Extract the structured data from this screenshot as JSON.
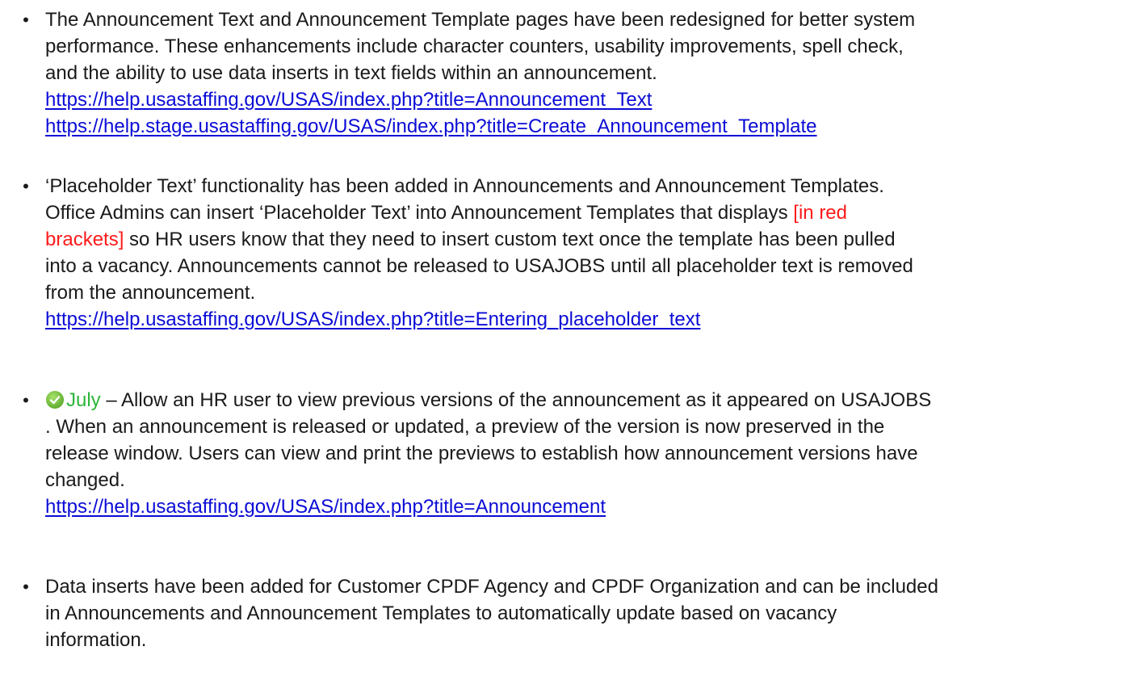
{
  "bullet_char": "•",
  "items": [
    {
      "lines": [
        "The Announcement Text and Announcement Template pages have been redesigned for better system",
        "performance.  These enhancements include character counters, usability improvements, spell check,",
        "and the ability to use data inserts in text fields within an announcement."
      ],
      "links": [
        "https://help.usastaffing.gov/USAS/index.php?title=Announcement_Text",
        "https://help.stage.usastaffing.gov/USAS/index.php?title=Create_Announcement_Template"
      ]
    },
    {
      "line1": "‘Placeholder Text’ functionality has been added in Announcements and Announcement Templates.",
      "line2_before": "Office Admins can insert ‘Placeholder Text’ into Announcement Templates that displays ",
      "line2_red": "[in red",
      "line3_red": "brackets]",
      "line3_after": " so HR users know that they need to insert custom text once the template has been pulled",
      "line4": "into a vacancy. Announcements cannot be released to USAJOBS until all placeholder text is removed",
      "line5": "from the announcement.",
      "link": "https://help.usastaffing.gov/USAS/index.php?title=Entering_placeholder_text"
    },
    {
      "icon": "check-circle-icon",
      "month": "July",
      "line1_after": " – Allow an HR user to view previous versions of the announcement as it appeared on USAJOBS",
      "line2": ". When an announcement is released or updated, a preview of the version is now preserved in the",
      "line3": "release window.  Users can view and print the previews to establish how announcement versions have",
      "line4": "changed.",
      "link": "https://help.usastaffing.gov/USAS/index.php?title=Announcement"
    },
    {
      "lines": [
        "Data inserts have been added for Customer CPDF Agency and CPDF Organization and can be included",
        "in Announcements and Announcement Templates to automatically update based on vacancy",
        "information."
      ]
    }
  ],
  "colors": {
    "link": "#0b0bd6",
    "placeholder_red": "#ff1a1a",
    "month_green": "#2db53a",
    "check_icon": "#7ac943"
  }
}
